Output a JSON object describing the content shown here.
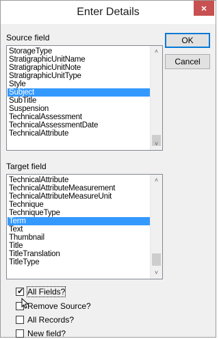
{
  "window": {
    "title": "Enter Details",
    "close_icon": "close-icon",
    "close_glyph": "×",
    "close_color": "#c75050"
  },
  "source_field": {
    "label": "Source field",
    "items": [
      "StorageType",
      "StratigraphicUnitName",
      "StratigraphicUnitNote",
      "StratigraphicUnitType",
      "Style",
      "Subject",
      "SubTitle",
      "Suspension",
      "TechnicalAssessment",
      "TechnicalAssessmentDate",
      "TechnicalAttribute"
    ],
    "selected": "Subject"
  },
  "target_field": {
    "label": "Target field",
    "items": [
      "TechnicalAttribute",
      "TechnicalAttributeMeasurement",
      "TechnicalAttributeMeasureUnit",
      "Technique",
      "TechniqueType",
      "Term",
      "Text",
      "Thumbnail",
      "Title",
      "TitleTranslation",
      "TitleType"
    ],
    "selected": "Term"
  },
  "buttons": {
    "ok": "OK",
    "cancel": "Cancel"
  },
  "options": {
    "all_fields": {
      "label": "All Fields?",
      "checked": true
    },
    "remove_source": {
      "label": "Remove Source?",
      "checked": false
    },
    "all_records": {
      "label": "All Records?",
      "checked": false
    },
    "new_field": {
      "label": "New field?",
      "checked": false
    }
  },
  "colors": {
    "selection": "#3399ff",
    "default_button_border": "#0078d7"
  }
}
